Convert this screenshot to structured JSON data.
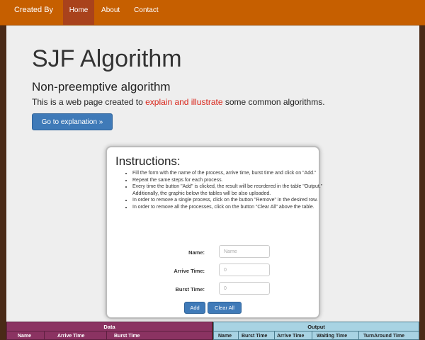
{
  "navbar": {
    "brand": "Created By",
    "items": [
      {
        "label": "Home",
        "active": true
      },
      {
        "label": "About",
        "active": false
      },
      {
        "label": "Contact",
        "active": false
      }
    ]
  },
  "hero": {
    "title": "SJF Algorithm",
    "subtitle": "Non-preemptive algorithm",
    "lead_before": "This is a web page created to ",
    "lead_highlight": "explain and illustrate",
    "lead_after": " some common algorithms.",
    "button_label": "Go to explanation »"
  },
  "instructions": {
    "title": "Instructions:",
    "items": [
      "Fill the form with the name of the process, arrive time, burst time and click on \"Add.\"",
      "Repeat the same steps for each process.",
      "Every time the button \"Add\" is clicked, the result will be reordered in the table \"Output.\" Additionally, the graphic below the tables will be also uploaded.",
      "In order to remove a single process, click on the button \"Remove\" in the desired row.",
      "In order to remove all the processes, click on the button \"Clear All\" above the table."
    ]
  },
  "form": {
    "name_label": "Name:",
    "name_placeholder": "Name",
    "arrive_label": "Arrive Time:",
    "arrive_placeholder": "0",
    "burst_label": "Burst Time:",
    "burst_placeholder": "0",
    "add_label": "Add",
    "clear_label": "Clear All"
  },
  "tables": {
    "data": {
      "caption": "Data",
      "columns": [
        "Name",
        "Arrive Time",
        "Burst Time"
      ]
    },
    "output": {
      "caption": "Output",
      "columns": [
        "Name",
        "Burst Time",
        "Arrive Time",
        "Waiting Time",
        "TurnAround Time"
      ]
    }
  },
  "colors": {
    "navbar": "#c65f00",
    "nav_active": "#a9421c",
    "primary_button": "#3f7ab8",
    "highlight_text": "#d9251a",
    "data_table": "#8b3362",
    "output_table": "#a8d3e3"
  }
}
